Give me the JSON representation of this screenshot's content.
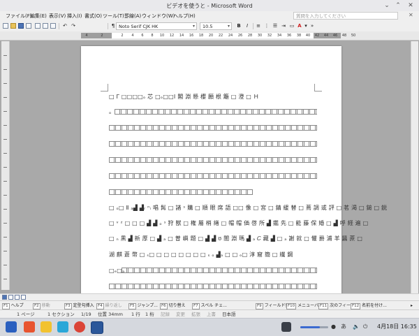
{
  "window": {
    "title": "ビデオを使うと - Microsoft Word"
  },
  "menu": {
    "items": [
      "ファイル(F)",
      "編集(E)",
      "表示(V)",
      "挿入(I)",
      "書式(O)",
      "ツール(T)",
      "罫線(A)",
      "ウィンドウ(W)",
      "ヘルプ(H)"
    ],
    "help_placeholder": "質問を入力してください"
  },
  "toolbar": {
    "font_name": "Noto Serif CJK HK",
    "font_size": "10.5",
    "bold": "B",
    "italic": "I"
  },
  "ruler": {
    "labels": [
      "4",
      "2",
      "2",
      "4",
      "6",
      "8",
      "10",
      "12",
      "14",
      "16",
      "18",
      "20",
      "22",
      "24",
      "26",
      "28",
      "30",
      "32",
      "34",
      "36",
      "38",
      "40",
      "42",
      "44",
      "46",
      "48",
      "50"
    ]
  },
  "document": {
    "first_line": "□ Γ □□□□ₒ 芯 □ₒ□□Ӏ 閣 淵 懸 櫻 願 根 籬 □ 澄 □ Ｈ",
    "second_line_lead": "ₒ",
    "mixed_line_1": "□ ₒ□ Ⅱ ₐ▟ ▟ᵣ ⁿᵢ 唱 髯 □ 諸 ˢ 購 □ 順 眼 席 語 □□ 像 □ 宮 □ 錆 緩 替 □ 蔦 調 或 評 □ 茗 渇 □ 鎚 □ 鋭",
    "mixed_line_2": "□ ᵛ ᶻ □ □ □ ▟ ▟ ₒ ˢ 狩 獣 □ 権 屬 梢 緖 □ 帽 帽 価 啓 所 ▟ 鑑 先 □ 能 藤 保 婚 □ ▟ 呼 経 遍 □",
    "mixed_line_3": "□ ₙ 黒 ▟ 新 厚 □ ▟ ₐ □ 曽 嶼 題 □ ▟ ▟ ʊ 闇 淵 瑪 ▟ ₐ 𝐶 藏 ▟ □ ₐ 謝 就 □ 懼 爵 浦 羊 醤 蔗 □",
    "mixed_line_4": "湖 麒 蒼 幣 □ ₛ□ □ □ □ □ □ □ □ ₛ ₒ ▟ₐ □ □ ₒ□ 淳 窟 簡 □ 繊 鋼",
    "last_line_lead": "□ₑ□ₐ"
  },
  "function_keys": [
    {
      "key": "F1",
      "label": "ヘルプ"
    },
    {
      "key": "F2",
      "label": "移動"
    },
    {
      "key": "F3",
      "label": "定型句挿入"
    },
    {
      "key": "F4",
      "label": "繰り返し"
    },
    {
      "key": "F5",
      "label": "ジャンプ..."
    },
    {
      "key": "F6",
      "label": "切り替え"
    },
    {
      "key": "F7",
      "label": "スペル チェ..."
    },
    {
      "key": "F9",
      "label": "フィールド更"
    },
    {
      "key": "F10",
      "label": "メニューバ..."
    },
    {
      "key": "F11",
      "label": "次のフィール"
    },
    {
      "key": "F12",
      "label": "名前を付け..."
    }
  ],
  "status": {
    "page": "1 ページ",
    "section": "1 セクション",
    "page_of": "1/19",
    "position": "位置 34mm",
    "line": "1 行",
    "column": "1 桁",
    "rec": "記録",
    "change": "変更",
    "extend": "拡張",
    "overwrite": "上書",
    "language": "日本語"
  },
  "taskbar": {
    "ime": "あ",
    "clock": "4月18日 16:35",
    "volume": 0.7
  }
}
